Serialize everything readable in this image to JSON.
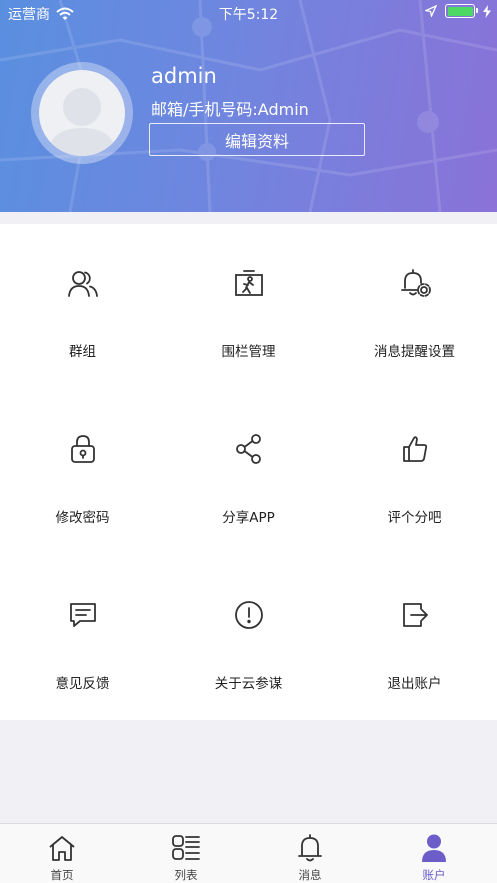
{
  "status_bar": {
    "carrier": "运营商",
    "time": "下午5:12",
    "battery_level": 1.0
  },
  "profile": {
    "username": "admin",
    "account_line": "邮箱/手机号码:Admin",
    "edit_button": "编辑资料"
  },
  "menu": {
    "items": [
      {
        "label": "群组",
        "icon": "group-icon"
      },
      {
        "label": "围栏管理",
        "icon": "fence-icon"
      },
      {
        "label": "消息提醒设置",
        "icon": "bell-settings-icon"
      },
      {
        "label": "修改密码",
        "icon": "lock-icon"
      },
      {
        "label": "分享APP",
        "icon": "share-icon"
      },
      {
        "label": "评个分吧",
        "icon": "thumbs-up-icon"
      },
      {
        "label": "意见反馈",
        "icon": "feedback-icon"
      },
      {
        "label": "关于云参谋",
        "icon": "info-icon"
      },
      {
        "label": "退出账户",
        "icon": "logout-icon"
      }
    ]
  },
  "tabbar": {
    "tabs": [
      {
        "label": "首页",
        "icon": "home-icon"
      },
      {
        "label": "列表",
        "icon": "list-icon"
      },
      {
        "label": "消息",
        "icon": "bell-icon"
      },
      {
        "label": "账户",
        "icon": "user-icon",
        "active": true
      }
    ]
  },
  "colors": {
    "header_gradient_start": "#5a8fe0",
    "header_gradient_end": "#8a72d8",
    "active_tab": "#6c5dc8",
    "battery": "#4cd964"
  }
}
